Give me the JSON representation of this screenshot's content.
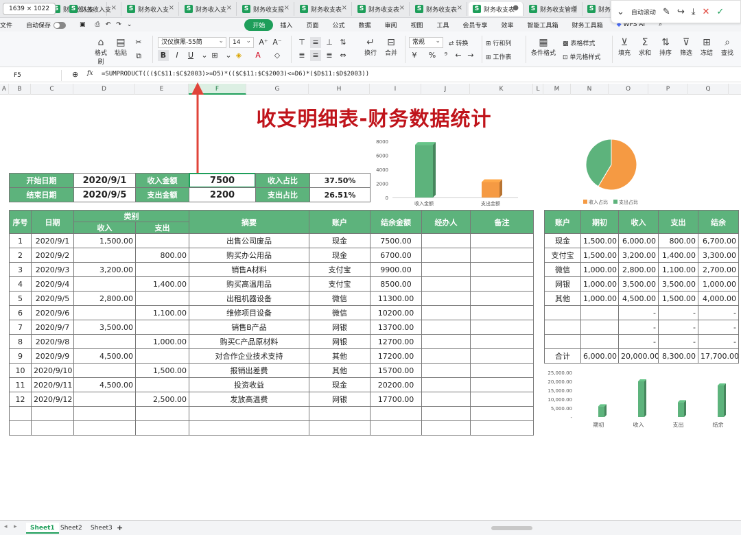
{
  "window": {
    "dimensions_badge": "1639 × 1022",
    "tabs": [
      {
        "label": "财务收入支",
        "active": false
      },
      {
        "label": "财务收入支",
        "active": false
      },
      {
        "label": "财务收入支",
        "active": false
      },
      {
        "label": "财务收入支",
        "active": false
      },
      {
        "label": "财务收支报",
        "active": false
      },
      {
        "label": "财务收支表",
        "active": false
      },
      {
        "label": "财务收支表",
        "active": false
      },
      {
        "label": "财务收支表",
        "active": true
      },
      {
        "label": "财务收支管理",
        "active": false
      },
      {
        "label": "财务收",
        "active": false
      }
    ],
    "auto_scroll_label": "自动滚动"
  },
  "menu": {
    "file": "文件",
    "autosave": "自动保存",
    "items": [
      "开始",
      "插入",
      "页面",
      "公式",
      "数据",
      "审阅",
      "视图",
      "工具",
      "会员专享",
      "效率",
      "智能工具箱",
      "财务工具箱",
      "WPS AI"
    ],
    "active": "开始"
  },
  "ribbon": {
    "format_painter": "格式刷",
    "paste": "粘贴",
    "font_name": "汉仪旗黑-55简",
    "font_size": "14",
    "number_format": "常规",
    "convert": "转换",
    "rows_cols": "行和列",
    "worksheet": "工作表",
    "wrap": "换行",
    "merge": "合并",
    "table_style": "表格样式",
    "cond_format": "条件格式",
    "cell_style": "单元格样式",
    "fill": "填充",
    "sum": "求和",
    "sort": "排序",
    "filter": "筛选",
    "freeze": "冻结",
    "find": "查找"
  },
  "formula_bar": {
    "cell_ref": "F5",
    "fx": "fx",
    "formula": "=SUMPRODUCT((($C$11:$C$2003)>=D5)*(($C$11:$C$2003)<=D6)*($D$11:$D$2003))"
  },
  "columns": [
    "A",
    "B",
    "C",
    "D",
    "E",
    "F",
    "G",
    "H",
    "I",
    "J",
    "K",
    "L",
    "M",
    "N",
    "O",
    "P",
    "Q"
  ],
  "selected_column": "F",
  "title": "收支明细表-财务数据统计",
  "summary": {
    "start_label": "开始日期",
    "start_value": "2020/9/1",
    "end_label": "结束日期",
    "end_value": "2020/9/5",
    "income_label": "收入金额",
    "income_value": "7500",
    "expense_label": "支出金额",
    "expense_value": "2200",
    "income_ratio_label": "收入占比",
    "income_ratio_value": "37.50%",
    "expense_ratio_label": "支出占比",
    "expense_ratio_value": "26.51%"
  },
  "detail_table": {
    "headers": {
      "seq": "序号",
      "date": "日期",
      "category": "类别",
      "income": "收入",
      "expense": "支出",
      "summary": "摘要",
      "account": "账户",
      "balance": "结余金额",
      "handler": "经办人",
      "note": "备注"
    },
    "rows": [
      {
        "seq": "1",
        "date": "2020/9/1",
        "income": "1,500.00",
        "expense": "",
        "summary": "出售公司废品",
        "account": "现金",
        "balance": "7500.00"
      },
      {
        "seq": "2",
        "date": "2020/9/2",
        "income": "",
        "expense": "800.00",
        "summary": "购买办公用品",
        "account": "现金",
        "balance": "6700.00"
      },
      {
        "seq": "3",
        "date": "2020/9/3",
        "income": "3,200.00",
        "expense": "",
        "summary": "销售A材料",
        "account": "支付宝",
        "balance": "9900.00"
      },
      {
        "seq": "4",
        "date": "2020/9/4",
        "income": "",
        "expense": "1,400.00",
        "summary": "购买高温用品",
        "account": "支付宝",
        "balance": "8500.00"
      },
      {
        "seq": "5",
        "date": "2020/9/5",
        "income": "2,800.00",
        "expense": "",
        "summary": "出租机器设备",
        "account": "微信",
        "balance": "11300.00"
      },
      {
        "seq": "6",
        "date": "2020/9/6",
        "income": "",
        "expense": "1,100.00",
        "summary": "维修项目设备",
        "account": "微信",
        "balance": "10200.00"
      },
      {
        "seq": "7",
        "date": "2020/9/7",
        "income": "3,500.00",
        "expense": "",
        "summary": "销售B产品",
        "account": "网银",
        "balance": "13700.00"
      },
      {
        "seq": "8",
        "date": "2020/9/8",
        "income": "",
        "expense": "1,000.00",
        "summary": "购买C产品原材料",
        "account": "网银",
        "balance": "12700.00"
      },
      {
        "seq": "9",
        "date": "2020/9/9",
        "income": "4,500.00",
        "expense": "",
        "summary": "对合作企业技术支持",
        "account": "其他",
        "balance": "17200.00"
      },
      {
        "seq": "10",
        "date": "2020/9/10",
        "income": "",
        "expense": "1,500.00",
        "summary": "报销出差费",
        "account": "其他",
        "balance": "15700.00"
      },
      {
        "seq": "11",
        "date": "2020/9/11",
        "income": "4,500.00",
        "expense": "",
        "summary": "投资收益",
        "account": "现金",
        "balance": "20200.00"
      },
      {
        "seq": "12",
        "date": "2020/9/12",
        "income": "",
        "expense": "2,500.00",
        "summary": "发放高温费",
        "account": "网银",
        "balance": "17700.00"
      },
      {
        "seq": "",
        "date": "",
        "income": "",
        "expense": "",
        "summary": "",
        "account": "",
        "balance": ""
      },
      {
        "seq": "",
        "date": "",
        "income": "",
        "expense": "",
        "summary": "",
        "account": "",
        "balance": ""
      }
    ]
  },
  "account_table": {
    "headers": [
      "账户",
      "期初",
      "收入",
      "支出",
      "结余"
    ],
    "rows": [
      [
        "现金",
        "1,500.00",
        "6,000.00",
        "800.00",
        "6,700.00"
      ],
      [
        "支付宝",
        "1,500.00",
        "3,200.00",
        "1,400.00",
        "3,300.00"
      ],
      [
        "微信",
        "1,000.00",
        "2,800.00",
        "1,100.00",
        "2,700.00"
      ],
      [
        "网银",
        "1,000.00",
        "3,500.00",
        "3,500.00",
        "1,000.00"
      ],
      [
        "其他",
        "1,000.00",
        "4,500.00",
        "1,500.00",
        "4,000.00"
      ],
      [
        "",
        "",
        "-",
        "-",
        "-"
      ],
      [
        "",
        "",
        "-",
        "-",
        "-"
      ],
      [
        "",
        "",
        "-",
        "-",
        "-"
      ],
      [
        "合计",
        "6,000.00",
        "20,000.00",
        "8,300.00",
        "17,700.00"
      ]
    ]
  },
  "sheets": {
    "tabs": [
      "Sheet1",
      "Sheet2",
      "Sheet3"
    ],
    "active": "Sheet1",
    "add": "+"
  },
  "chart_data": [
    {
      "type": "bar",
      "categories": [
        "收入金额",
        "支出金额"
      ],
      "values": [
        7500,
        2200
      ],
      "ylim": [
        0,
        8000
      ],
      "yticks": [
        "0",
        "2000",
        "4000",
        "6000",
        "8000"
      ],
      "colors": [
        "#5db37c",
        "#f59a43"
      ]
    },
    {
      "type": "pie",
      "categories": [
        "收入占比",
        "支出占比"
      ],
      "values": [
        37.5,
        26.51
      ],
      "legend": "bottom",
      "colors": [
        "#f59a43",
        "#5db37c"
      ]
    },
    {
      "type": "bar",
      "categories": [
        "期初",
        "收入",
        "支出",
        "结余"
      ],
      "values": [
        6000,
        20000,
        8300,
        17700
      ],
      "ylim": [
        0,
        25000
      ],
      "yticks": [
        "-",
        "5,000.00",
        "10,000.00",
        "15,000.00",
        "20,000.00",
        "25,000.00"
      ],
      "colors": [
        "#5db37c"
      ]
    }
  ]
}
